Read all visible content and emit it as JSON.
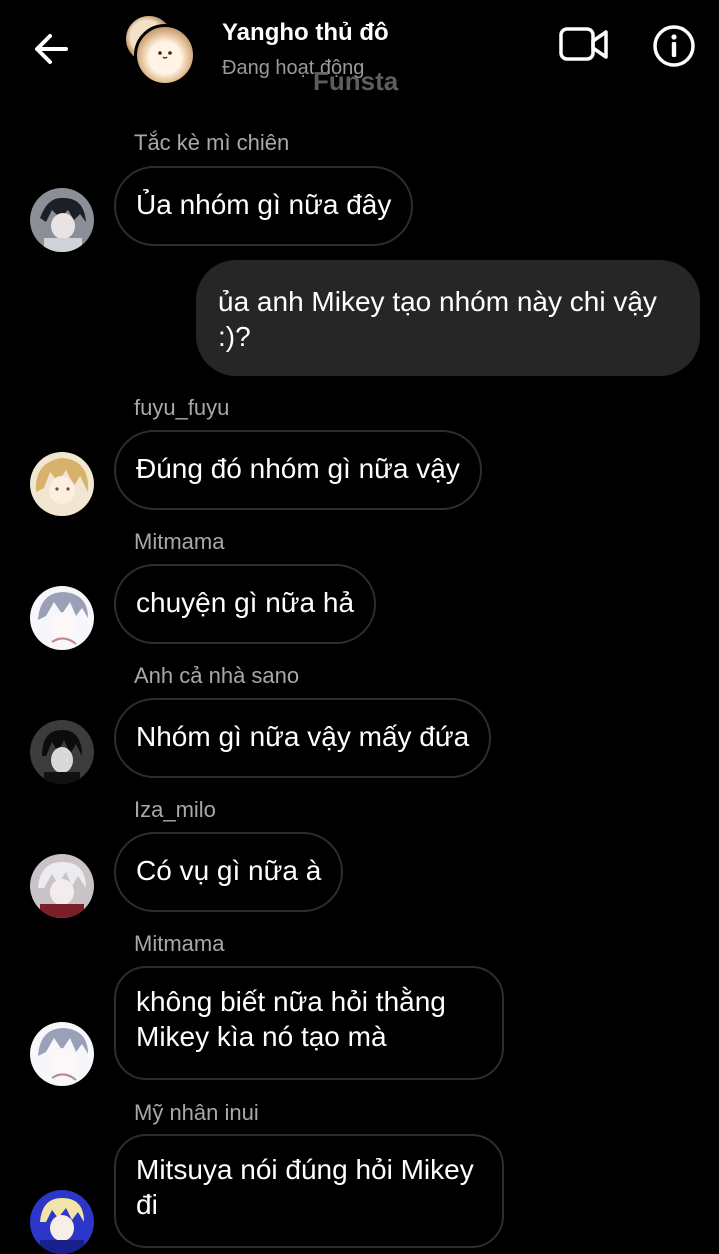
{
  "header": {
    "title": "Yangho thủ đô",
    "status": "Đang hoạt động",
    "watermark": "Funsta",
    "icons": {
      "back": "arrow-left-icon",
      "video": "video-call-icon",
      "info": "info-icon"
    }
  },
  "messages": [
    {
      "sender": "Tắc kè mì chiên",
      "text": "Ủa nhóm gì nữa đây"
    },
    {
      "sender": "",
      "text": "ủa anh Mikey tạo nhóm này chi vậy :)?",
      "outgoing": true
    },
    {
      "sender": "fuyu_fuyu",
      "text": "Đúng đó nhóm gì nữa vậy"
    },
    {
      "sender": "Mitmama",
      "text": " chuyện gì nữa hả"
    },
    {
      "sender": "Anh cả nhà sano",
      "text": "Nhóm gì nữa vậy mấy đứa"
    },
    {
      "sender": "Iza_milo",
      "text": "Có vụ gì nữa à"
    },
    {
      "sender": "Mitmama",
      "text": "không biết nữa hỏi thằng Mikey kìa nó tạo mà"
    },
    {
      "sender": "Mỹ nhân inui",
      "text": "Mitsuya nói đúng hỏi Mikey đi"
    }
  ],
  "colors": {
    "background": "#000000",
    "outgoing_bubble": "#262626",
    "incoming_border": "#2d2d2d",
    "secondary_text": "#a8a8a8"
  }
}
